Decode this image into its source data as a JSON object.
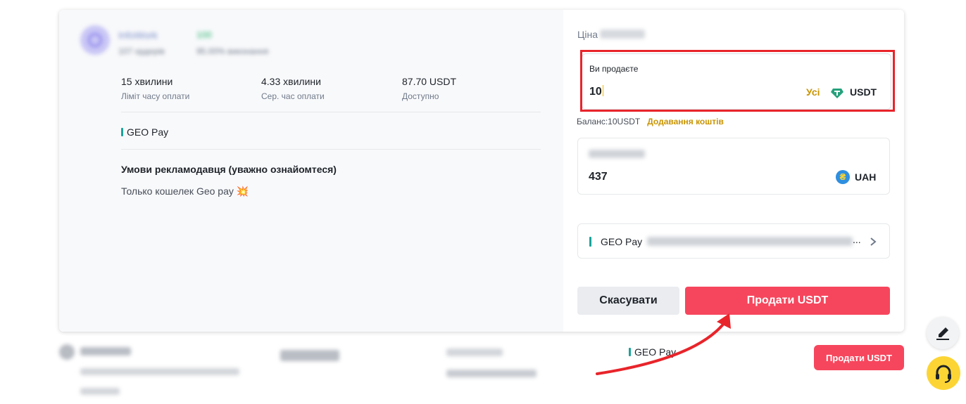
{
  "merchant": {
    "name": "InfoWork",
    "badge": "100",
    "stats": "107 ордерів",
    "completion": "95.00% виконання"
  },
  "stats": [
    {
      "value": "15 хвилини",
      "label": "Ліміт часу оплати"
    },
    {
      "value": "4.33 хвилини",
      "label": "Сер. час оплати"
    },
    {
      "value": "87.70 USDT",
      "label": "Доступно"
    }
  ],
  "payment_tag": "GEO Pay",
  "terms": {
    "title": "Умови рекламодавця (уважно ознайомтеся)",
    "text": "Только кошелек Geo pay 💥"
  },
  "form": {
    "price_label": "Ціна",
    "sell_label": "Ви продаєте",
    "sell_value": "10",
    "sell_all": "Усі",
    "sell_currency": "USDT",
    "balance": "Баланс:10USDT",
    "add_funds": "Додавання коштів",
    "receive_value": "437",
    "receive_currency": "UAH",
    "uah_symbol": "₴",
    "method_name": "GEO Pay",
    "method_dots": "...",
    "cancel_label": "Скасувати",
    "sell_button_label": "Продати USDT"
  },
  "row": {
    "payment": "GEO Pay",
    "sell_button_label": "Продати USDT"
  },
  "colors": {
    "sell_red": "#f6465d",
    "accent_yellow": "#c99400",
    "highlight_red": "#e8242a",
    "geo_teal": "#1aa39a",
    "support_yellow": "#fcd535"
  }
}
